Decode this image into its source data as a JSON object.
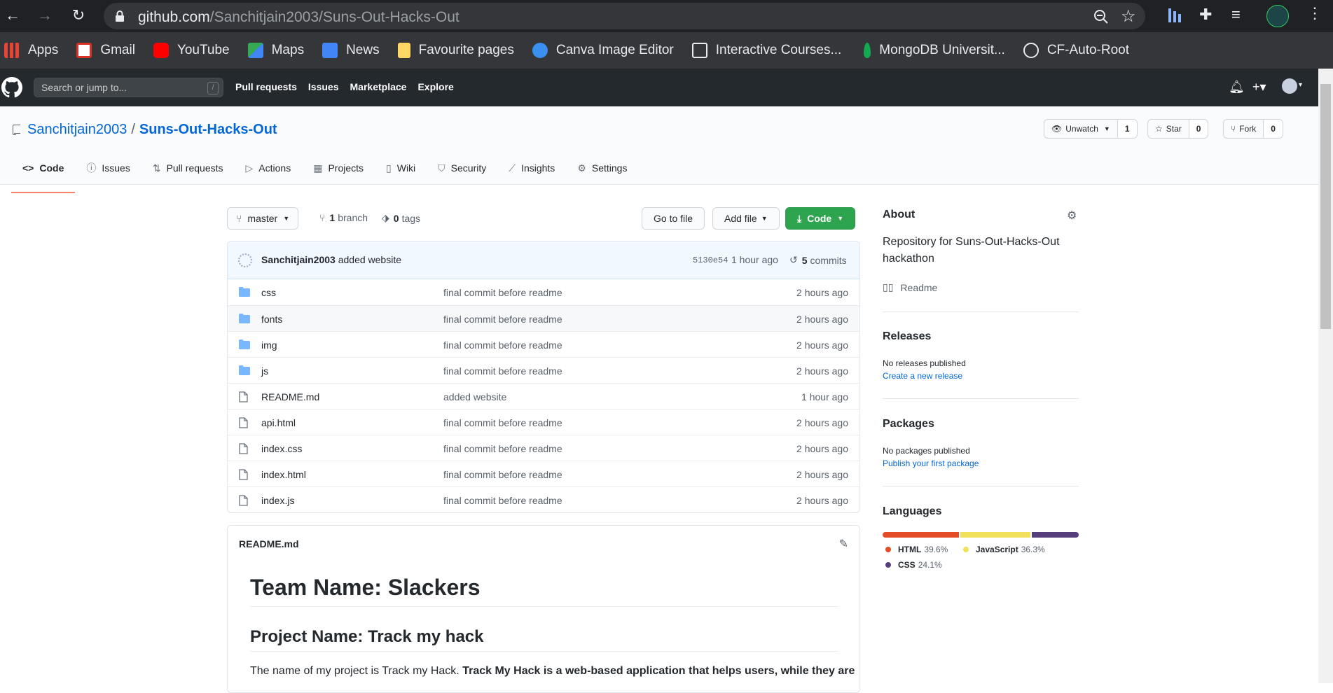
{
  "browser": {
    "url_host": "github.com",
    "url_path": "/Sanchitjain2003/Suns-Out-Hacks-Out",
    "bookmarks": [
      {
        "label": "Apps",
        "color": "#ea4335"
      },
      {
        "label": "Gmail",
        "color": "#d93025"
      },
      {
        "label": "YouTube",
        "color": "#ff0000"
      },
      {
        "label": "Maps",
        "color": "#34a853"
      },
      {
        "label": "News",
        "color": "#4285f4"
      },
      {
        "label": "Favourite pages",
        "color": "#fdd663"
      },
      {
        "label": "Canva Image Editor",
        "color": "#3a8ff0"
      },
      {
        "label": "Interactive Courses...",
        "color": "#e8eaed"
      },
      {
        "label": "MongoDB Universit...",
        "color": "#13aa52"
      },
      {
        "label": "CF-Auto-Root",
        "color": "#e8eaed"
      }
    ]
  },
  "gh_header": {
    "search_placeholder": "Search or jump to...",
    "search_key": "/",
    "nav": [
      "Pull requests",
      "Issues",
      "Marketplace",
      "Explore"
    ]
  },
  "repo": {
    "owner": "Sanchitjain2003",
    "separator": "/",
    "name": "Suns-Out-Hacks-Out",
    "watch_label": "Unwatch",
    "watch_count": "1",
    "star_label": "Star",
    "star_count": "0",
    "fork_label": "Fork",
    "fork_count": "0",
    "tabs": [
      "Code",
      "Issues",
      "Pull requests",
      "Actions",
      "Projects",
      "Wiki",
      "Security",
      "Insights",
      "Settings"
    ]
  },
  "toolbar": {
    "branch": "master",
    "branch_count": "1",
    "branch_word": "branch",
    "tag_count": "0",
    "tag_word": "tags",
    "go_to_file": "Go to file",
    "add_file": "Add file",
    "code": "Code"
  },
  "commit": {
    "author": "Sanchitjain2003",
    "message": "added website",
    "sha": "5130e54",
    "ago": "1 hour ago",
    "count": "5",
    "count_word": "commits"
  },
  "files": [
    {
      "name": "css",
      "type": "dir",
      "message": "final commit before readme",
      "age": "2 hours ago"
    },
    {
      "name": "fonts",
      "type": "dir",
      "message": "final commit before readme",
      "age": "2 hours ago"
    },
    {
      "name": "img",
      "type": "dir",
      "message": "final commit before readme",
      "age": "2 hours ago"
    },
    {
      "name": "js",
      "type": "dir",
      "message": "final commit before readme",
      "age": "2 hours ago"
    },
    {
      "name": "README.md",
      "type": "file",
      "message": "added website",
      "age": "1 hour ago"
    },
    {
      "name": "api.html",
      "type": "file",
      "message": "final commit before readme",
      "age": "2 hours ago"
    },
    {
      "name": "index.css",
      "type": "file",
      "message": "final commit before readme",
      "age": "2 hours ago"
    },
    {
      "name": "index.html",
      "type": "file",
      "message": "final commit before readme",
      "age": "2 hours ago"
    },
    {
      "name": "index.js",
      "type": "file",
      "message": "final commit before readme",
      "age": "2 hours ago"
    }
  ],
  "readme": {
    "filename": "README.md",
    "h1": "Team Name: Slackers",
    "h2": "Project Name: Track my hack",
    "p_plain": "The name of my project is Track my Hack. ",
    "p_bold": "Track My Hack is a web-based application that helps users, while they are"
  },
  "sidebar": {
    "about": "About",
    "description": "Repository for Suns-Out-Hacks-Out hackathon",
    "readme": "Readme",
    "releases": "Releases",
    "no_releases": "No releases published",
    "create_release": "Create a new release",
    "packages": "Packages",
    "no_packages": "No packages published",
    "publish_package": "Publish your first package",
    "languages": "Languages",
    "langs": [
      {
        "name": "HTML",
        "pct": "39.6%",
        "value": 39.6,
        "color": "#e34c26"
      },
      {
        "name": "JavaScript",
        "pct": "36.3%",
        "value": 36.3,
        "color": "#f1e05a"
      },
      {
        "name": "CSS",
        "pct": "24.1%",
        "value": 24.1,
        "color": "#563d7c"
      }
    ]
  }
}
